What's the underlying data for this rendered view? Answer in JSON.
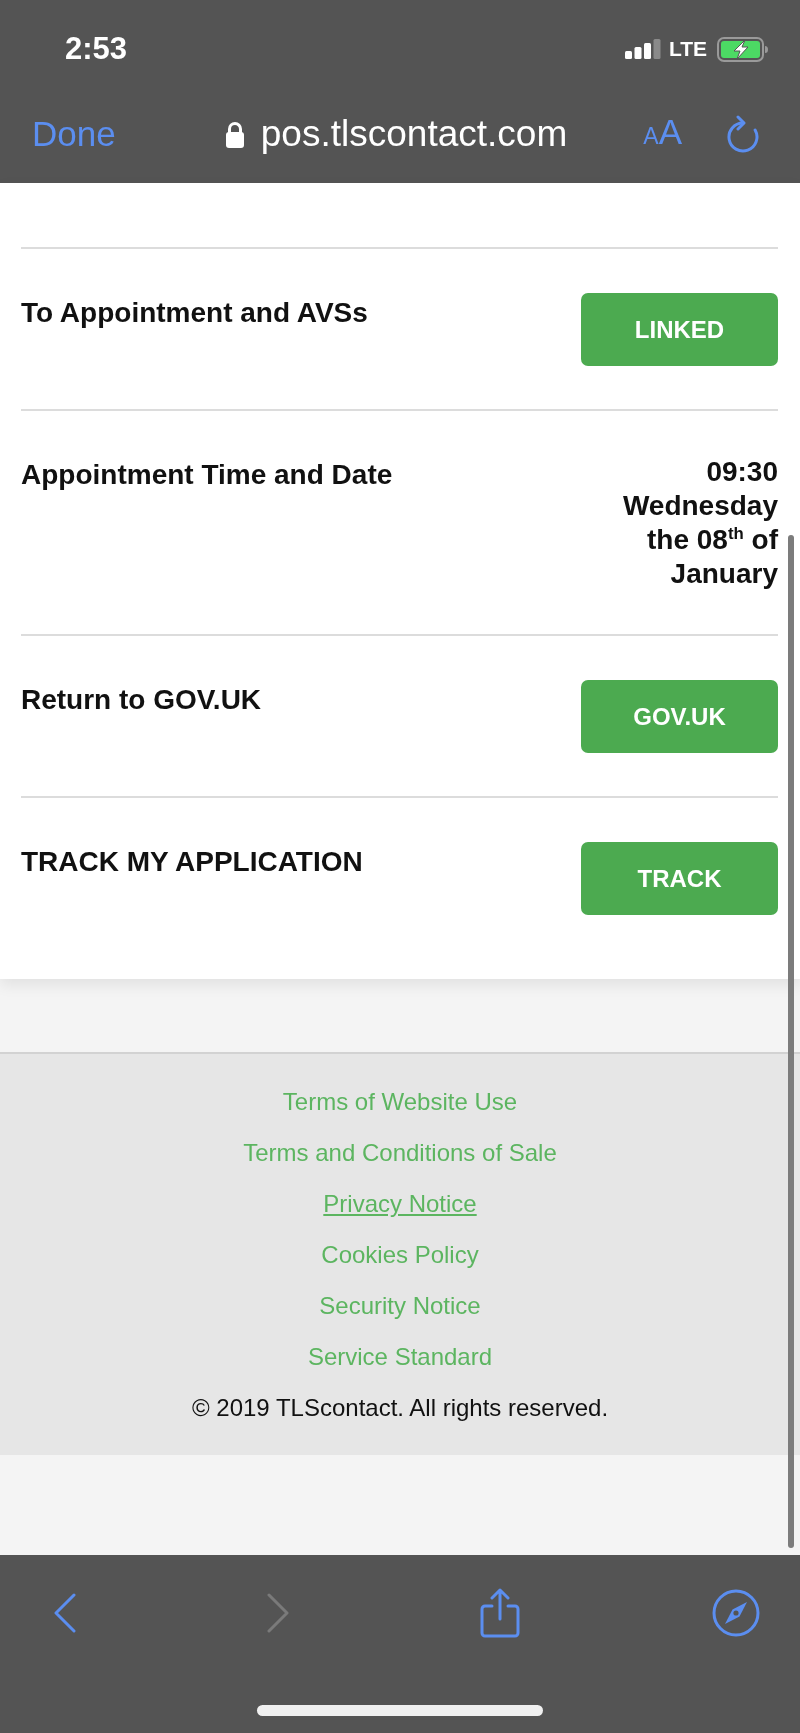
{
  "status_bar": {
    "time": "2:53",
    "network": "LTE"
  },
  "browser_bar": {
    "done": "Done",
    "url": "pos.tlscontact.com",
    "text_size": "AA"
  },
  "rows": [
    {
      "kind": "button",
      "label": "To Appointment and AVSs",
      "button": "LINKED"
    },
    {
      "kind": "value",
      "label": "Appointment Time and Date",
      "value": "09:30 Wednesday the 08$^{th}$ of January"
    },
    {
      "kind": "button",
      "label": "Return to GOV.UK",
      "button": "GOV.UK"
    },
    {
      "kind": "button",
      "label": "TRACK MY APPLICATION",
      "button": "TRACK"
    }
  ],
  "footer": {
    "links": [
      {
        "label": "Terms of Website Use",
        "focused": false
      },
      {
        "label": "Terms and Conditions of Sale",
        "focused": false
      },
      {
        "label": "Privacy Notice",
        "focused": true
      },
      {
        "label": "Cookies Policy",
        "focused": false
      },
      {
        "label": "Security Notice",
        "focused": false
      },
      {
        "label": "Service Standard",
        "focused": false
      }
    ],
    "copyright": "© 2019 TLScontact. All rights reserved."
  },
  "toolbar": [
    {
      "kind": "back",
      "disabled": false
    },
    {
      "kind": "forward",
      "disabled": true
    },
    {
      "kind": "share",
      "disabled": false
    },
    {
      "kind": "compass",
      "disabled": false
    }
  ]
}
